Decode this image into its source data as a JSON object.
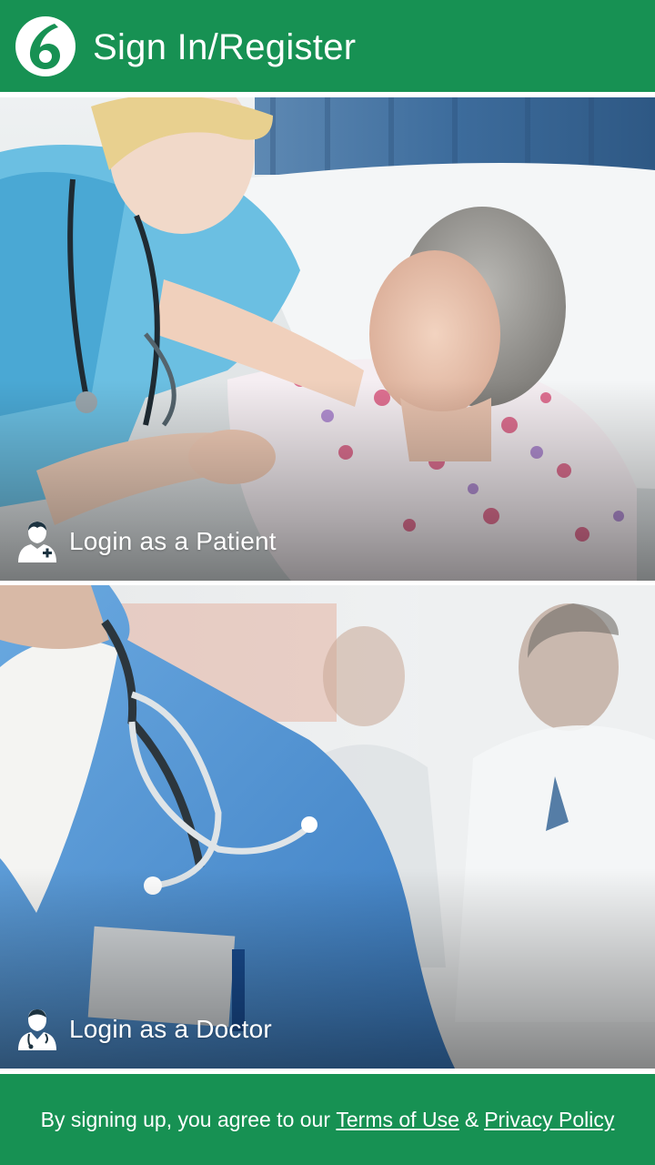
{
  "header": {
    "title": "Sign In/Register",
    "logo_icon": "brand-logo-icon",
    "background_color": "#179153"
  },
  "options": {
    "patient": {
      "label": "Login as a Patient",
      "icon": "patient-user-icon"
    },
    "doctor": {
      "label": "Login as a Doctor",
      "icon": "doctor-user-icon"
    }
  },
  "footer": {
    "prefix": "By signing up, you agree to our",
    "terms_label": "Terms of Use",
    "separator": "&",
    "privacy_label": "Privacy Policy"
  },
  "colors": {
    "brand_green": "#179153",
    "text_on_brand": "#ffffff"
  }
}
